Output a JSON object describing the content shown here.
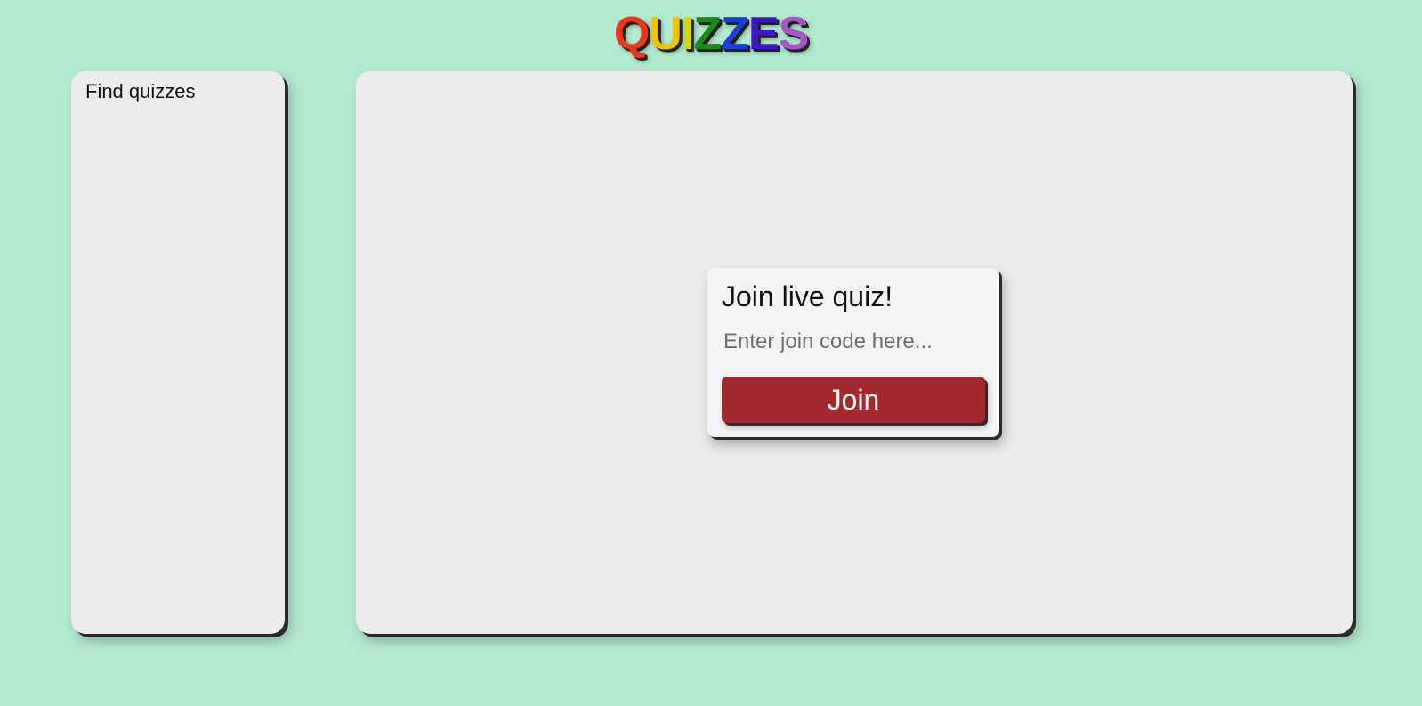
{
  "header": {
    "logo_letters": [
      "Q",
      "U",
      "I",
      "Z",
      "Z",
      "E",
      "S"
    ],
    "logo_colors": [
      "#e8381c",
      "#f2c200",
      "#d8d800",
      "#1a8a1a",
      "#1b3fd8",
      "#3b18c8",
      "#a855c8"
    ]
  },
  "sidebar": {
    "title": "Find quizzes"
  },
  "join_card": {
    "title": "Join live quiz!",
    "input_placeholder": "Enter join code here...",
    "input_value": "",
    "button_label": "Join"
  },
  "colors": {
    "background": "#b3ead0",
    "panel": "#ececec",
    "card": "#f4f4f4",
    "button": "#a22a2f"
  }
}
